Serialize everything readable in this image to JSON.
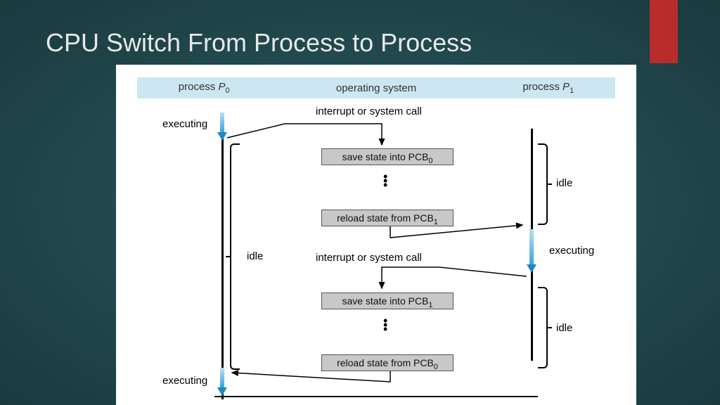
{
  "slide": {
    "title": "CPU Switch From Process to Process"
  },
  "header": {
    "col_p0_a": "process ",
    "col_p0_b": "P",
    "col_p0_sub": "0",
    "col_os": "operating system",
    "col_p1_a": "process ",
    "col_p1_b": "P",
    "col_p1_sub": "1"
  },
  "labels": {
    "interrupt1": "interrupt or system call",
    "interrupt2": "interrupt or system call",
    "executing1": "executing",
    "executing2": "executing",
    "executing3": "executing",
    "idle1": "idle",
    "idle2": "idle",
    "idle3": "idle"
  },
  "boxes": {
    "save0_a": "save state into PCB",
    "save0_sub": "0",
    "reload1_a": "reload state from PCB",
    "reload1_sub": "1",
    "save1_a": "save state into PCB",
    "save1_sub": "1",
    "reload0_a": "reload state from PCB",
    "reload0_sub": "0"
  }
}
